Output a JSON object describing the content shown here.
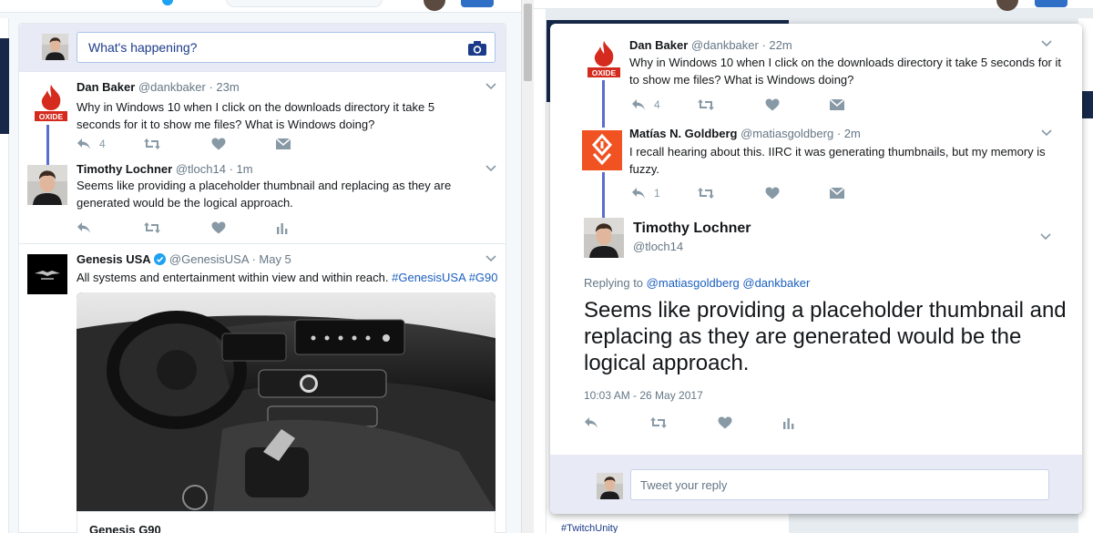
{
  "colors": {
    "accent": "#1da1f2",
    "link": "#1b5fbf",
    "thread_line": "#5b6cd1",
    "oxide_red": "#d52b1e",
    "matias_orange": "#f05222",
    "compose_bg": "#e8eaf6"
  },
  "left_column": {
    "compose": {
      "placeholder": "What's happening?",
      "icon": "camera-icon"
    },
    "tweets": [
      {
        "name": "Dan Baker",
        "handle": "@dankbaker",
        "time": "· 23m",
        "text": "Why in Windows 10 when I click on the downloads directory it take 5 seconds for it to show me files? What is Windows doing?",
        "reply_count": "4",
        "avatar_icon": "oxide-logo-icon"
      },
      {
        "name": "Timothy Lochner",
        "handle": "@tloch14",
        "time": "· 1m",
        "text": "Seems like providing a placeholder thumbnail and replacing as they are generated would be the logical approach.",
        "avatar_icon": "person-avatar"
      },
      {
        "name": "Genesis USA",
        "handle": "@GenesisUSA",
        "time": "· May 5",
        "text": "All systems and entertainment within view and within reach.",
        "hashtag1": "#GenesisUSA",
        "hashtag2": "#G90",
        "avatar_icon": "genesis-logo-icon",
        "card_title": "Genesis G90"
      }
    ]
  },
  "modal": {
    "thread": [
      {
        "name": "Dan Baker",
        "handle": "@dankbaker",
        "time": "· 22m",
        "text": "Why in Windows 10 when I click on the downloads directory it take 5 seconds for it to show me files? What is Windows doing?",
        "reply_count": "4"
      },
      {
        "name": "Matías N. Goldberg",
        "handle": "@matiasgoldberg",
        "time": "· 2m",
        "text": "I recall hearing about this. IIRC it was generating thumbnails, but my memory is fuzzy.",
        "reply_count": "1"
      }
    ],
    "main": {
      "name": "Timothy Lochner",
      "handle": "@tloch14",
      "replying_label": "Replying to",
      "replying_to": "@matiasgoldberg @dankbaker",
      "text": "Seems like providing a placeholder thumbnail and replacing as they are generated would be the logical approach.",
      "datetime": "10:03 AM - 26 May 2017"
    },
    "reply_placeholder": "Tweet your reply"
  },
  "background": {
    "bottom_text": "#TwitchUnity"
  }
}
